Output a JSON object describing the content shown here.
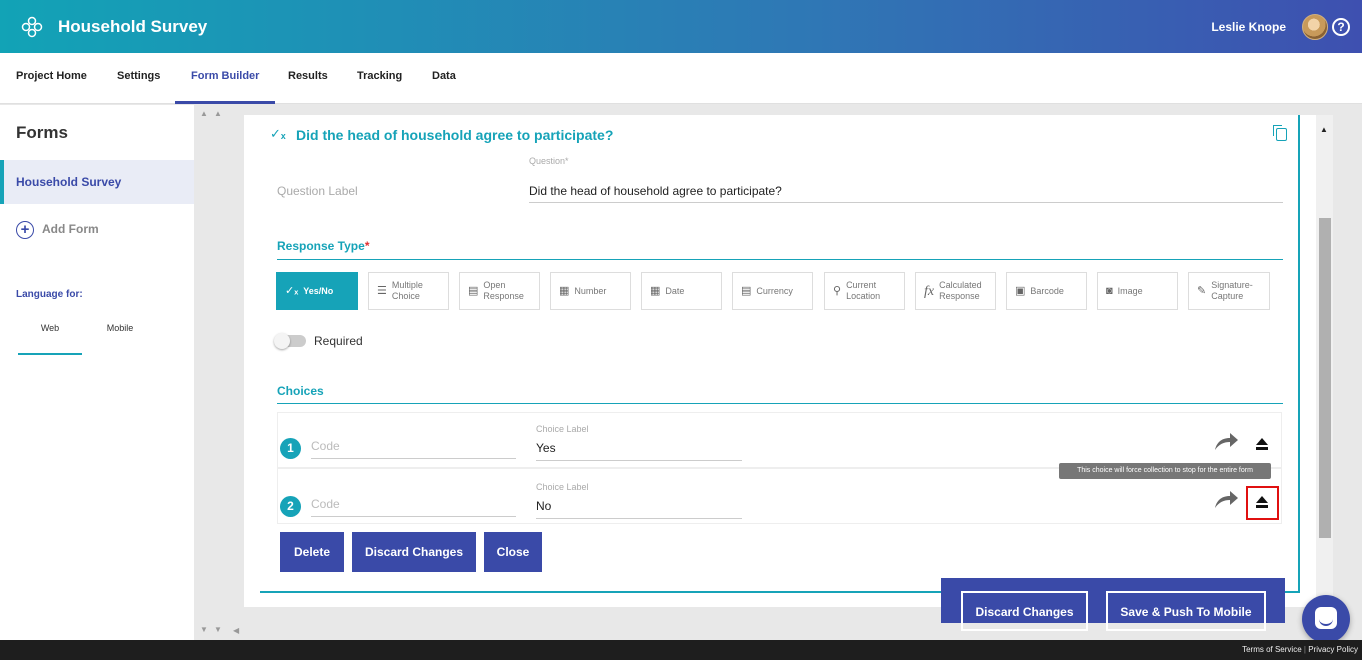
{
  "header": {
    "app_title": "Household Survey",
    "user_name": "Leslie Knope",
    "help_symbol": "?"
  },
  "nav": {
    "items": [
      "Project Home",
      "Settings",
      "Form Builder",
      "Results",
      "Tracking",
      "Data"
    ],
    "active": "Form Builder"
  },
  "sidebar": {
    "title": "Forms",
    "forms": [
      "Household Survey"
    ],
    "add_form": "Add Form",
    "language_label": "Language for:",
    "language_tabs": [
      "Web",
      "Mobile"
    ],
    "active_language": "Web"
  },
  "question": {
    "title": "Did the head of household agree to participate?",
    "label_text": "Question Label",
    "caption": "Question*",
    "value": "Did the head of household agree to participate?"
  },
  "response_type": {
    "heading": "Response Type",
    "required_mark": "*",
    "options": [
      {
        "label": "Yes/No",
        "icon": "yes-no-icon"
      },
      {
        "label": "Multiple Choice",
        "icon": "list-icon"
      },
      {
        "label": "Open Response",
        "icon": "text-icon"
      },
      {
        "label": "Number",
        "icon": "number-icon"
      },
      {
        "label": "Date",
        "icon": "calendar-icon"
      },
      {
        "label": "Currency",
        "icon": "currency-icon"
      },
      {
        "label": "Current Location",
        "icon": "location-icon"
      },
      {
        "label": "Calculated Response",
        "icon": "fx-icon"
      },
      {
        "label": "Barcode",
        "icon": "barcode-icon"
      },
      {
        "label": "Image",
        "icon": "camera-icon"
      },
      {
        "label": "Signature-Capture",
        "icon": "pen-icon"
      }
    ],
    "active": "Yes/No"
  },
  "required_label": "Required",
  "choices": {
    "heading": "Choices",
    "code_placeholder": "Code",
    "caption": "Choice Label",
    "rows": [
      {
        "number": "1",
        "label": "Yes"
      },
      {
        "number": "2",
        "label": "No"
      }
    ]
  },
  "tooltip": "This choice will force collection to stop for the entire form",
  "buttons": {
    "delete": "Delete",
    "discard": "Discard Changes",
    "close": "Close"
  },
  "actionbar": {
    "discard": "Discard Changes",
    "save_push": "Save & Push To Mobile"
  },
  "footer": {
    "terms": "Terms of Service",
    "privacy": "Privacy Policy",
    "separator": "|"
  },
  "colors": {
    "accent": "#16a3b8",
    "primary": "#3a4aa8",
    "highlight": "#e01010"
  }
}
